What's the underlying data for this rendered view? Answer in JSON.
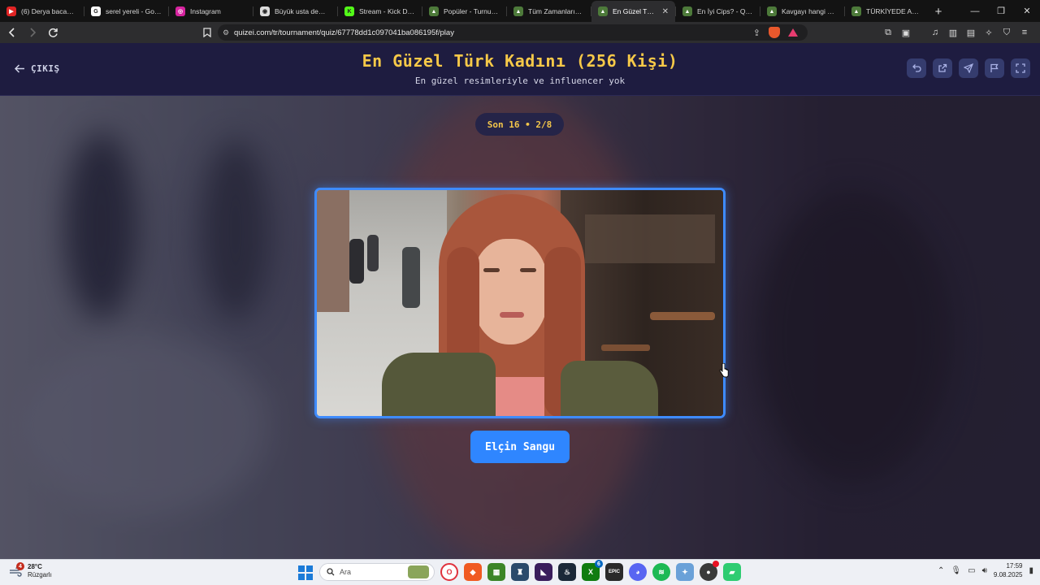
{
  "browser": {
    "tabs": [
      {
        "title": "(6) Derya bacağına",
        "fav_color": "#e02424",
        "fav_glyph": "▶",
        "active": false
      },
      {
        "title": "serel yereli - Google",
        "fav_color": "#ffffff",
        "fav_glyph": "G",
        "active": false
      },
      {
        "title": "Instagram",
        "fav_color": "#d6249f",
        "fav_glyph": "◎",
        "active": false
      },
      {
        "title": "Büyük usta demirci",
        "fav_color": "#dddddd",
        "fav_glyph": "◉",
        "active": false
      },
      {
        "title": "Stream - Kick Dashb",
        "fav_color": "#53fc18",
        "fav_glyph": "K",
        "active": false
      },
      {
        "title": "Popüler - Turnuva -",
        "fav_color": "#4d7a3a",
        "fav_glyph": "▲",
        "active": false
      },
      {
        "title": "Tüm Zamanların En",
        "fav_color": "#4d7a3a",
        "fav_glyph": "▲",
        "active": false
      },
      {
        "title": "En Güzel Türk K",
        "fav_color": "#4d7a3a",
        "fav_glyph": "▲",
        "active": true
      },
      {
        "title": "En İyi Cips? - Quizei",
        "fav_color": "#4d7a3a",
        "fav_glyph": "▲",
        "active": false
      },
      {
        "title": "Kavgayı hangi hayva",
        "fav_color": "#4d7a3a",
        "fav_glyph": "▲",
        "active": false
      },
      {
        "title": "TÜRKİYEDE ABARTI",
        "fav_color": "#4d7a3a",
        "fav_glyph": "▲",
        "active": false
      }
    ],
    "new_tab_label": "+",
    "url": "quizei.com/tr/tournament/quiz/67778dd1c097041ba086195f/play"
  },
  "quiz": {
    "exit_label": "ÇIKIŞ",
    "title": "En Güzel Türk Kadını (256 Kişi)",
    "subtitle": "En güzel resimleriyle ve influencer yok",
    "round": "Son 16 • 2/8",
    "choice_label": "Elçin Sangu"
  },
  "colors": {
    "title_gold": "#f7c948",
    "accent_blue": "#2f86ff",
    "header_bg": "#1e1c40"
  },
  "taskbar": {
    "weather_temp": "28°C",
    "weather_desc": "Rüzgarlı",
    "weather_badge": "4",
    "search_placeholder": "Ara",
    "clock_time": "17:59",
    "clock_date": "9.08.2025",
    "xbox_badge": "6"
  }
}
